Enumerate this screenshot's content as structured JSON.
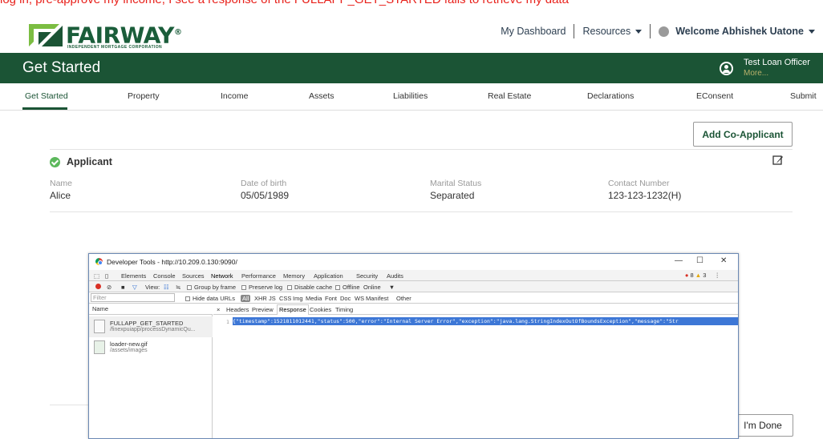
{
  "annotation_top": "log in, pre-approve my income, I see a response of the FULLAPP_GET_STARTED fails to retrieve my data",
  "brand": {
    "name": "FAIRWAY",
    "registered": "®",
    "tagline": "INDEPENDENT MORTGAGE CORPORATION",
    "green": "#1b5435"
  },
  "topnav": {
    "dashboard": "My Dashboard",
    "resources": "Resources",
    "welcome": "Welcome Abhishek Uatone"
  },
  "header": {
    "title": "Get Started",
    "user_name": "Test Loan Officer",
    "user_more": "More..."
  },
  "tabs": [
    "Get Started",
    "Property",
    "Income",
    "Assets",
    "Liabilities",
    "Real Estate",
    "Declarations",
    "EConsent",
    "Submit"
  ],
  "buttons": {
    "add_co_applicant": "Add Co-Applicant",
    "done": "I'm Done"
  },
  "applicant": {
    "heading": "Applicant",
    "fields": [
      {
        "label": "Name",
        "value": "Alice"
      },
      {
        "label": "Date of birth",
        "value": "05/05/1989"
      },
      {
        "label": "Marital Status",
        "value": "Separated"
      },
      {
        "label": "Contact Number",
        "value": "123-123-1232(H)"
      }
    ]
  },
  "devtools": {
    "title": "Developer Tools - http://10.209.0.130:9090/",
    "window_controls": {
      "minimize": "—",
      "maximize": "☐",
      "close": "✕"
    },
    "panels": [
      "Elements",
      "Console",
      "Sources",
      "Network",
      "Performance",
      "Memory",
      "Application",
      "Security",
      "Audits"
    ],
    "active_panel": "Network",
    "errors": "8",
    "warnings": "3",
    "toolbar": {
      "view": "View:",
      "group_by_frame": "Group by frame",
      "preserve_log": "Preserve log",
      "disable_cache": "Disable cache",
      "offline": "Offline",
      "online": "Online"
    },
    "filter": {
      "placeholder": "Filter",
      "hide_data_urls": "Hide data URLs",
      "all": "All",
      "types": [
        "XHR",
        "JS",
        "CSS",
        "Img",
        "Media",
        "Font",
        "Doc",
        "WS",
        "Manifest",
        "Other"
      ]
    },
    "name_header": "Name",
    "requests": [
      {
        "name": "FULLAPP_GET_STARTED",
        "path": "/finexpuiapp/processDynamicQu..."
      },
      {
        "name": "loader-new.gif",
        "path": "/assets/images"
      }
    ],
    "detail_tabs": [
      "Headers",
      "Preview",
      "Response",
      "Cookies",
      "Timing"
    ],
    "active_detail_tab": "Response",
    "close_x": "×",
    "line_no": "1",
    "response_text": "{\"timestamp\":1521811012441,\"status\":500,\"error\":\"Internal Server Error\",\"exception\":\"java.lang.StringIndexOutOfBoundsException\",\"message\":\"Str"
  }
}
